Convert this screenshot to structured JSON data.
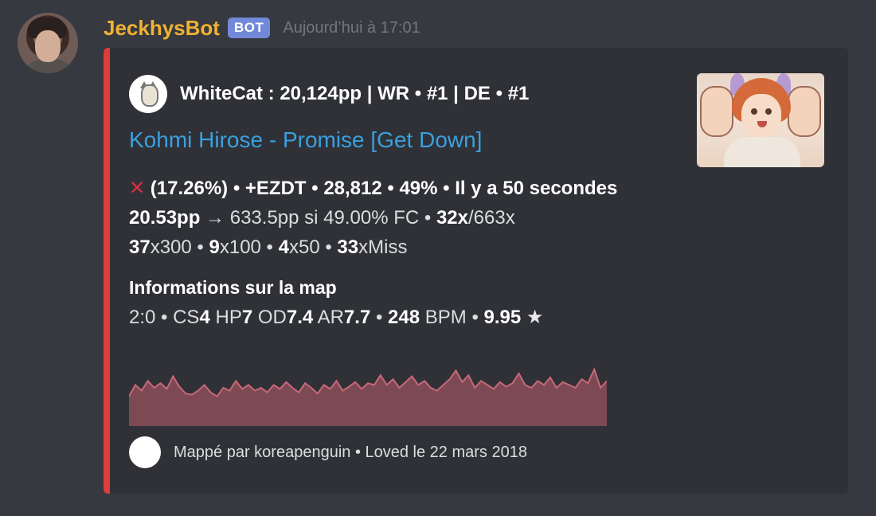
{
  "message": {
    "username": "JeckhysBot",
    "bot_tag": "BOT",
    "timestamp": "Aujourd’hui à 17:01"
  },
  "embed": {
    "accent_color": "#e03c3c",
    "author": "WhiteCat : 20,124pp | WR • #1 | DE • #1",
    "title": "Kohmi Hirose - Promise [Get Down]",
    "title_color": "#3aa0e0",
    "score_line": {
      "icon": "cross-mark-icon",
      "text": "(17.26%) • +EZDT • 28,812 • 49% • Il y a 50 secondes"
    },
    "pp_line": {
      "pp": "20.53pp",
      "rest": " → 633.5pp si 49.00% FC • ",
      "combo": "32x",
      "max_combo": "/663x"
    },
    "hits_line": {
      "n300": "37",
      "n300_label": "x300 • ",
      "n100": "9",
      "n100_label": "x100 • ",
      "n50": "4",
      "n50_label": "x50 • ",
      "miss": "33",
      "miss_label": "xMiss"
    },
    "field_name": "Informations sur la map",
    "map_info": {
      "length": "2:0 • CS",
      "cs": "4",
      "hp_label": " HP",
      "hp": "7",
      "od_label": " OD",
      "od": "7.4",
      "ar_label": " AR",
      "ar": "7.7",
      "sep": " • ",
      "bpm": "248",
      "bpm_label": " BPM • ",
      "stars": "9.95",
      "star_icon": "★"
    },
    "strain_graph": {
      "color": "#7d4a53",
      "line_color": "#c8687a",
      "values": [
        0.35,
        0.55,
        0.45,
        0.62,
        0.5,
        0.58,
        0.48,
        0.7,
        0.52,
        0.4,
        0.38,
        0.45,
        0.55,
        0.42,
        0.35,
        0.5,
        0.45,
        0.62,
        0.48,
        0.55,
        0.45,
        0.5,
        0.42,
        0.55,
        0.48,
        0.6,
        0.5,
        0.42,
        0.58,
        0.5,
        0.4,
        0.55,
        0.48,
        0.62,
        0.45,
        0.52,
        0.6,
        0.48,
        0.58,
        0.55,
        0.72,
        0.55,
        0.65,
        0.5,
        0.6,
        0.7,
        0.55,
        0.62,
        0.5,
        0.45,
        0.55,
        0.65,
        0.8,
        0.6,
        0.72,
        0.5,
        0.62,
        0.55,
        0.48,
        0.6,
        0.52,
        0.58,
        0.75,
        0.55,
        0.5,
        0.62,
        0.55,
        0.68,
        0.5,
        0.6,
        0.55,
        0.5,
        0.65,
        0.58,
        0.82,
        0.5,
        0.62
      ]
    },
    "footer": "Mappé par koreapenguin • Loved le 22 mars 2018"
  }
}
